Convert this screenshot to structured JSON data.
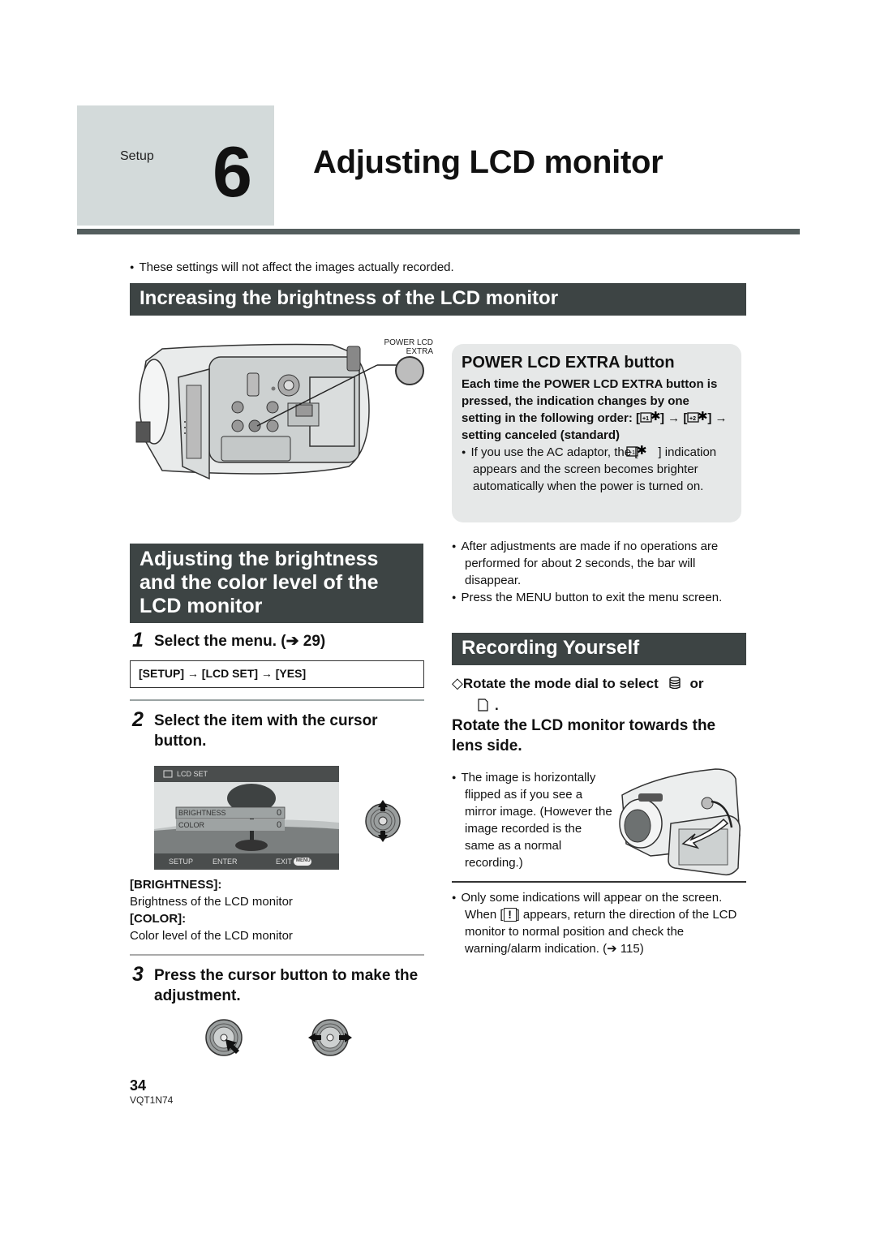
{
  "header": {
    "chapter_label": "Setup",
    "chapter_number": "6",
    "title": "Adjusting LCD monitor"
  },
  "intro_note": "These settings will not affect the images actually recorded.",
  "section_brightness": {
    "heading": "Increasing the brightness of the LCD monitor",
    "illustration": {
      "callout_label_line1": "POWER LCD",
      "callout_label_line2": "EXTRA"
    },
    "info_box": {
      "title": "POWER LCD EXTRA button",
      "text_part1": "Each time the POWER LCD EXTRA button is pressed, the indication changes by one setting in the following order: [",
      "icon1_text": "+1",
      "text_part2": "] → [",
      "icon2_text": "+2",
      "text_part3": "] → setting canceled (standard)",
      "bullet_part1": "If you use the AC adaptor, the [",
      "bullet_part2": "] indication appears and the screen becomes brighter automatically when the power is turned on."
    }
  },
  "section_adjust": {
    "heading_line1": "Adjusting the brightness",
    "heading_line2": "and the color level of the",
    "heading_line3": "LCD monitor",
    "steps": [
      {
        "number": "1",
        "text": "Select the menu. (➔ 29)"
      },
      {
        "number": "2",
        "text": "Select the item with the cursor button."
      },
      {
        "number": "3",
        "text": "Press the cursor button to make the adjustment."
      }
    ],
    "menu_path": "[SETUP] → [LCD SET] → [YES]",
    "lcd_screen": {
      "title": "LCD SET",
      "items": [
        {
          "label": "BRIGHTNESS",
          "value": "0"
        },
        {
          "label": "COLOR",
          "value": "0"
        }
      ],
      "footer_left": "SETUP",
      "footer_enter": "ENTER",
      "footer_exit": "EXIT",
      "footer_menu": "MENU"
    },
    "descriptions": [
      {
        "label": "[BRIGHTNESS]:",
        "text": "Brightness of the LCD monitor"
      },
      {
        "label": "[COLOR]:",
        "text": "Color level of the LCD monitor"
      }
    ],
    "after_notes": [
      "After adjustments are made if no operations are performed for about 2 seconds, the bar will disappear.",
      "Press the MENU button to exit the menu screen."
    ]
  },
  "section_recording": {
    "heading": "Recording Yourself",
    "mode_dial_part1": "Rotate the mode dial to select",
    "mode_dial_or": "or",
    "mode_dial_end": ".",
    "rotate_heading": "Rotate the LCD monitor towards the lens side.",
    "flip_note": "The image is horizontally flipped as if you see a mirror image. (However the image recorded is the same as a normal recording.)",
    "warn_part1": "Only some indications will appear on the screen. When [",
    "warn_icon": "!",
    "warn_part2": "] appears, return the direction of the LCD monitor to normal position and check the warning/alarm indication. (➔ 115)"
  },
  "footer": {
    "page_number": "34",
    "doc_code": "VQT1N74"
  }
}
